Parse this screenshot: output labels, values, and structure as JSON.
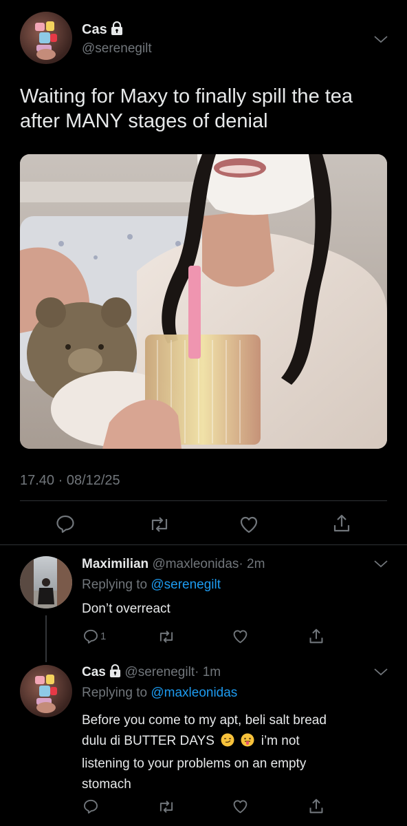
{
  "main_tweet": {
    "name": "Cas",
    "handle": "@serenegilt",
    "text_line1": "Waiting for Maxy to finally spill the tea",
    "text_line2": "after MANY stages of denial",
    "timestamp": "17.40 · 08/12/25"
  },
  "replies": [
    {
      "name": "Maximilian",
      "handle": "@maxleonidas",
      "time": "· 2m",
      "replying_label": "Replying to",
      "replying_to": "@serenegilt",
      "text": "Don’t overreact",
      "reply_count": "1"
    },
    {
      "name": "Cas",
      "handle": "@serenegilt",
      "time": "· 1m",
      "replying_label": "Replying to",
      "replying_to": "@maxleonidas",
      "text_line1": "Before you come to my apt, beli salt bread",
      "text_line2a": "dulu di BUTTER DAYS",
      "text_line2b": "i’m not",
      "text_line3": "listening to your problems on an empty",
      "text_line4": "stomach"
    }
  ],
  "colors": {
    "background": "#000000",
    "text": "#e7e9ea",
    "muted": "#71767b",
    "link": "#1d9bf0",
    "divider": "#2f3336"
  }
}
